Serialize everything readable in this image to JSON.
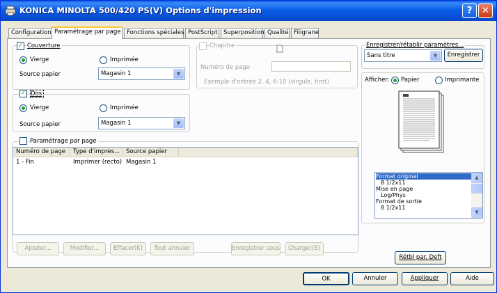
{
  "title": "KONICA MINOLTA 500/420 PS(V) Options d'impression",
  "help_label": "?",
  "close_label": "✕",
  "tabs": [
    "Configuration",
    "Paramétrage par page",
    "Fonctions spéciales",
    "PostScript",
    "Superposition",
    "Qualité",
    "Filigrane"
  ],
  "cover": {
    "label": "Couverture",
    "checked": true,
    "opt_blank": "Vierge",
    "opt_printed": "Imprimée",
    "source_label": "Source papier",
    "source_value": "Magasin 1"
  },
  "back": {
    "label": "Dos",
    "checked": true,
    "opt_blank": "Vierge",
    "opt_printed": "Imprimée",
    "source_label": "Source papier",
    "source_value": "Magasin 1"
  },
  "chapter": {
    "label": "Chapitre",
    "page_number_label": "Numéro de page",
    "example": "Exemple d'entrée 2, 4, 6-10 (virgule, tiret)"
  },
  "per_page": {
    "label": "Paramétrage par page",
    "columns": [
      "Numéro de page",
      "Type d'impres...",
      "Source papier"
    ],
    "rows": [
      [
        "1 - Fin",
        "Imprimer (recto)",
        "Magasin 1"
      ]
    ]
  },
  "buttons": {
    "add": "Ajouter...",
    "modify": "Modifier...",
    "delete": "Effacer(K)",
    "cancel_all": "Tout annuler",
    "save_as": "Enregistrer sous",
    "load": "Charger(E)"
  },
  "save_restore": {
    "label": "Enregistrer/rétablir paramètres...",
    "value": "Sans titre",
    "button": "Enregistrer"
  },
  "display": {
    "label": "Afficher:",
    "opt_paper": "Papier",
    "opt_printer": "Imprimante"
  },
  "settings_list": [
    "Format original",
    "8 1/2x11",
    "Mise en page",
    "Log/Phys",
    "Format de sortie",
    "8 1/2x11"
  ],
  "restore_default": "Rétbl par. Deft",
  "footer": {
    "ok": "OK",
    "cancel": "Annuler",
    "apply": "Appliquer",
    "help": "Aide"
  }
}
